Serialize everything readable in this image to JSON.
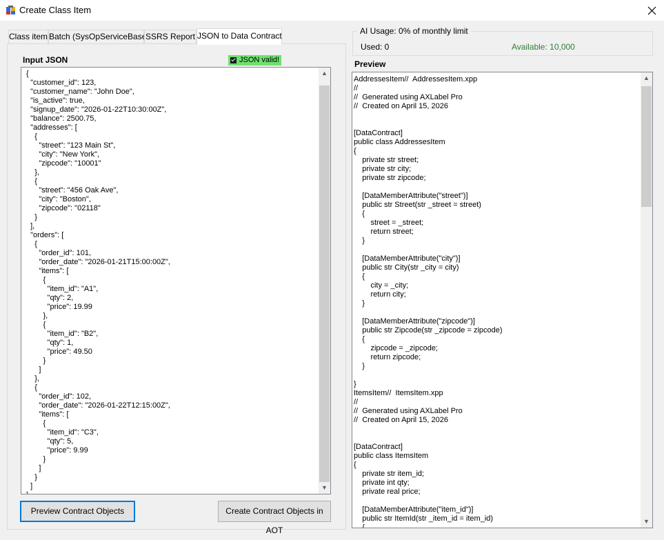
{
  "window": {
    "title": "Create Class Item",
    "close_icon": "close-icon"
  },
  "tabs": [
    {
      "label": "Class item",
      "active": false
    },
    {
      "label": "Batch (SysOpServiceBase)",
      "active": false
    },
    {
      "label": "SSRS Report",
      "active": false
    },
    {
      "label": "JSON to Data Contract",
      "active": true
    }
  ],
  "input": {
    "label": "Input JSON",
    "valid_text": "JSON valid!",
    "valid_color": "#6ee06e",
    "json_text": "{\n  \"customer_id\": 123,\n  \"customer_name\": \"John Doe\",\n  \"is_active\": true,\n  \"signup_date\": \"2026-01-22T10:30:00Z\",\n  \"balance\": 2500.75,\n  \"addresses\": [\n    {\n      \"street\": \"123 Main St\",\n      \"city\": \"New York\",\n      \"zipcode\": \"10001\"\n    },\n    {\n      \"street\": \"456 Oak Ave\",\n      \"city\": \"Boston\",\n      \"zipcode\": \"02118\"\n    }\n  ],\n  \"orders\": [\n    {\n      \"order_id\": 101,\n      \"order_date\": \"2026-01-21T15:00:00Z\",\n      \"items\": [\n        {\n          \"item_id\": \"A1\",\n          \"qty\": 2,\n          \"price\": 19.99\n        },\n        {\n          \"item_id\": \"B2\",\n          \"qty\": 1,\n          \"price\": 49.50\n        }\n      ]\n    },\n    {\n      \"order_id\": 102,\n      \"order_date\": \"2026-01-22T12:15:00Z\",\n      \"items\": [\n        {\n          \"item_id\": \"C3\",\n          \"qty\": 5,\n          \"price\": 9.99\n        }\n      ]\n    }\n  ]\n}"
  },
  "buttons": {
    "preview": "Preview Contract Objects",
    "create_aot": "Create Contract Objects in AOT"
  },
  "ai_usage": {
    "legend": "AI Usage: 0% of monthly limit",
    "used": "Used: 0",
    "available": "Available: 10,000",
    "available_color": "#2e7d32"
  },
  "preview": {
    "label": "Preview",
    "code_text": "AddressesItem//  AddressesItem.xpp\n//\n//  Generated using AXLabel Pro\n//  Created on April 15, 2026\n\n\n[DataContract]\npublic class AddressesItem\n{\n    private str street;\n    private str city;\n    private str zipcode;\n\n    [DataMemberAttribute(\"street\")]\n    public str Street(str _street = street)\n    {\n        street = _street;\n        return street;\n    }\n\n    [DataMemberAttribute(\"city\")]\n    public str City(str _city = city)\n    {\n        city = _city;\n        return city;\n    }\n\n    [DataMemberAttribute(\"zipcode\")]\n    public str Zipcode(str _zipcode = zipcode)\n    {\n        zipcode = _zipcode;\n        return zipcode;\n    }\n\n}\nItemsItem//  ItemsItem.xpp\n//\n//  Generated using AXLabel Pro\n//  Created on April 15, 2026\n\n\n[DataContract]\npublic class ItemsItem\n{\n    private str item_id;\n    private int qty;\n    private real price;\n\n    [DataMemberAttribute(\"item_id\")]\n    public str ItemId(str _item_id = item_id)\n    {"
  }
}
